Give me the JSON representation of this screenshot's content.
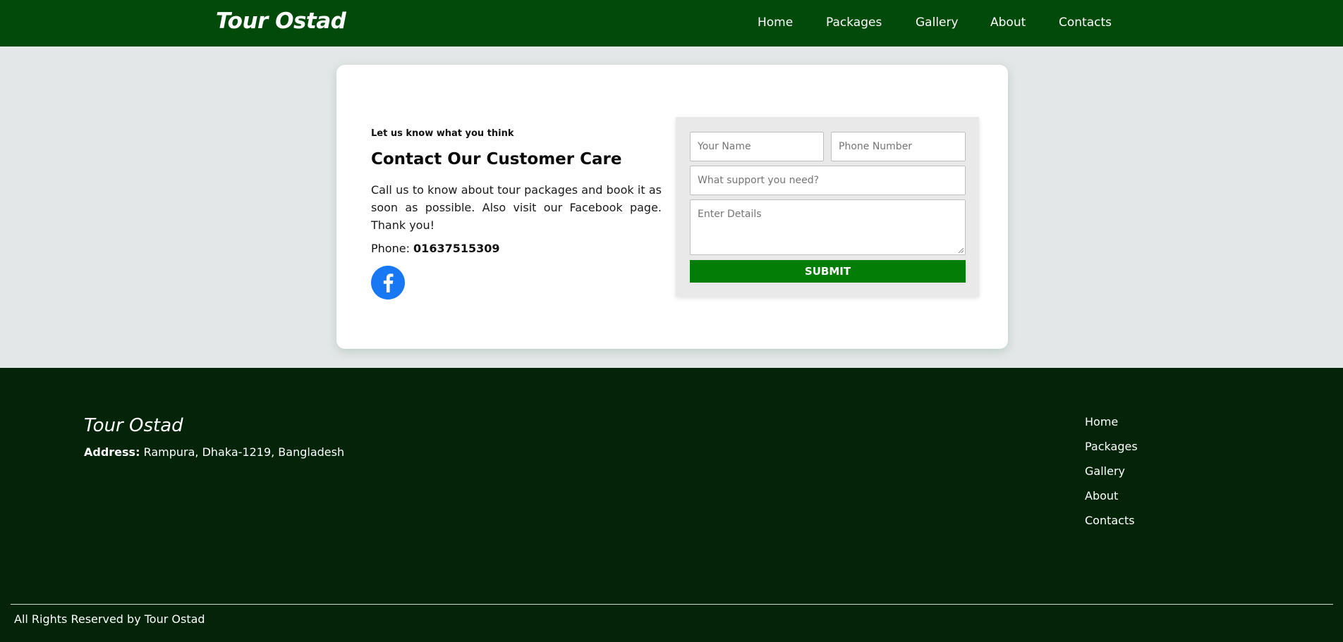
{
  "header": {
    "brand": "Tour Ostad",
    "nav": [
      "Home",
      "Packages",
      "Gallery",
      "About",
      "Contacts"
    ],
    "background": "#024a0a"
  },
  "contact": {
    "eyebrow": "Let us know what you think",
    "title": "Contact Our Customer Care",
    "description": "Call us to know about tour packages and book it as soon as possible. Also visit our Facebook page. Thank you!",
    "phone_label": "Phone:",
    "phone_number": "01637515309",
    "social_icon": "facebook-icon",
    "facebook_color": "#1877f2"
  },
  "form": {
    "name_placeholder": "Your Name",
    "phone_placeholder": "Phone Number",
    "support_placeholder": "What support you need?",
    "details_placeholder": "Enter Details",
    "submit_label": "SUBMIT",
    "submit_color": "#047d06"
  },
  "footer": {
    "brand": "Tour Ostad",
    "address_label": "Address:",
    "address_value": "Rampura, Dhaka-1219, Bangladesh",
    "links": [
      "Home",
      "Packages",
      "Gallery",
      "About",
      "Contacts"
    ],
    "copyright": "All Rights Reserved by Tour Ostad",
    "background": "#032408"
  }
}
